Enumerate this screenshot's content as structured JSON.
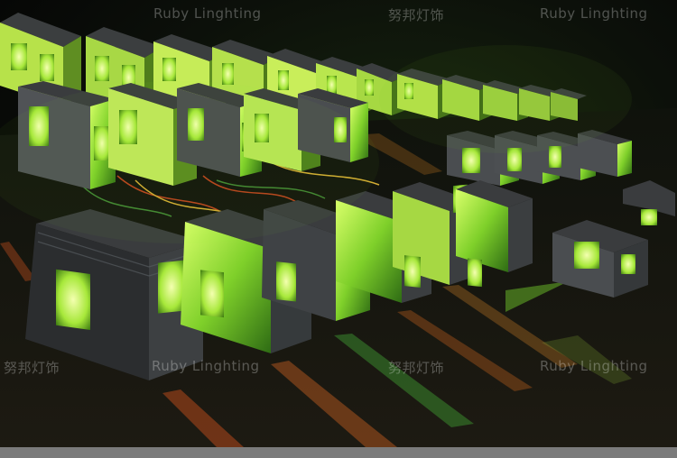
{
  "watermarks": {
    "top_cn": "努邦灯饰",
    "top_en_left": "Ruby Linghting",
    "top_en_right": "Ruby Linghting",
    "bottom_cn_left": "努邦灯饰",
    "bottom_en_center": "Ruby Linghting",
    "bottom_cn_center": "努邦灯饰",
    "bottom_en_right": "Ruby Linghting"
  },
  "colors": {
    "background": "#0b0b0b",
    "lamp_body": "#2e3032",
    "glow": "#9cff3a",
    "bottom_bar": "#7b7b7b"
  }
}
